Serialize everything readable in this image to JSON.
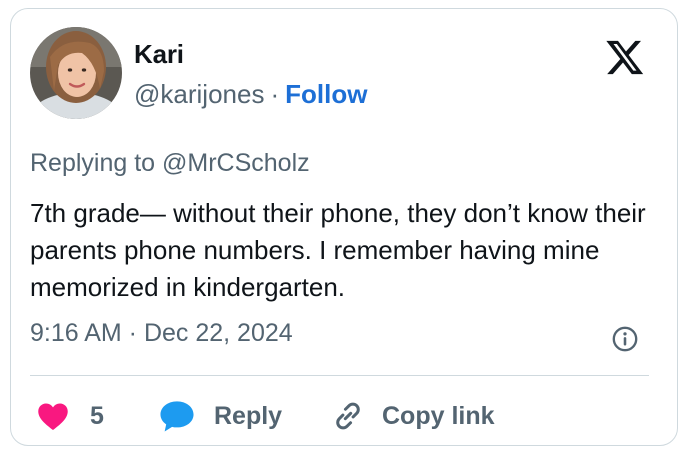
{
  "author": {
    "name": "Kari",
    "handle": "@karijones",
    "separator": "·",
    "follow_label": "Follow"
  },
  "reply_to": "Replying to @MrCScholz",
  "text": "7th grade— without their phone, they don’t know their parents phone numbers. I remember having mine memorized in kindergarten.",
  "timestamp": "9:16 AM · Dec 22, 2024",
  "actions": {
    "like_count": "5",
    "reply_label": "Reply",
    "copy_label": "Copy link"
  },
  "colors": {
    "accent": "#1d6fd6",
    "heart": "#f91880",
    "reply_bubble": "#1d9bf0",
    "muted": "#536471",
    "border": "#cfd9de"
  },
  "icons": [
    "x-logo-icon",
    "info-icon",
    "heart-icon",
    "reply-bubble-icon",
    "link-icon"
  ]
}
